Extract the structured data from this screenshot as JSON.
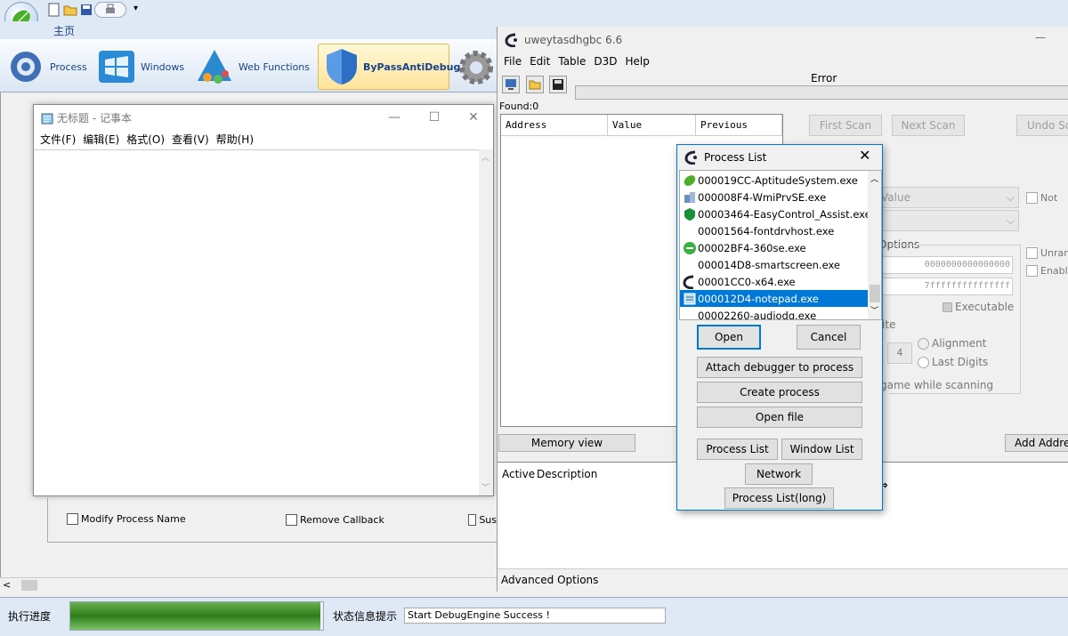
{
  "outer": {
    "home_tab": "主页",
    "ribbon": [
      {
        "label": "Process",
        "icon": "process-icon"
      },
      {
        "label": "Windows",
        "icon": "windows-icon"
      },
      {
        "label": "Web Functions",
        "icon": "web-icon"
      },
      {
        "label": "ByPassAntiDebug",
        "icon": "shield-icon",
        "selected": true
      }
    ],
    "checkboxes": [
      "Modify Process Name",
      "Remove Callback",
      "Sus"
    ],
    "hscroll_left": "<",
    "progress_label": "执行进度",
    "progress_value": 0.99,
    "status_label": "状态信息提示",
    "status_text": "Start DebugEngine Success !"
  },
  "notepad": {
    "title": "无标题 - 记事本",
    "menu": [
      "文件(F)",
      "编辑(E)",
      "格式(O)",
      "查看(V)",
      "帮助(H)"
    ],
    "minimize": "—",
    "maximize": "☐",
    "close": "✕"
  },
  "ce": {
    "title": "uweytasdhgbc 6.6",
    "minimize": "—",
    "menu": [
      "File",
      "Edit",
      "Table",
      "D3D",
      "Help"
    ],
    "error_label": "Error",
    "found_label": "Found:0",
    "columns": [
      "Address",
      "Value",
      "Previous"
    ],
    "first_scan": "First Scan",
    "next_scan": "Next Scan",
    "undo_scan": "Undo Sc",
    "value_type": "Value",
    "not_label": "Not",
    "options_label": "Options",
    "start_addr": "0000000000000000",
    "stop_addr": "7fffffffffffffff",
    "executable": "Executable",
    "writable_suffix": "ite",
    "align_value": "4",
    "alignment": "Alignment",
    "last_digits": "Last Digits",
    "pause_text": "game while scanning",
    "unrandomizer": "Unran",
    "enable_speed": "Enabl",
    "memory_view": "Memory view",
    "add_address": "Add Addre",
    "active_col": "Active",
    "description_col": "Description",
    "advanced_options": "Advanced Options"
  },
  "process_list": {
    "title": "Process List",
    "close": "✕",
    "items": [
      {
        "text": "000019CC-AptitudeSystem.exe",
        "icon": "leaf-icon"
      },
      {
        "text": "000008F4-WmiPrvSE.exe",
        "icon": "wmi-icon"
      },
      {
        "text": "00003464-EasyControl_Assist.exe",
        "icon": "shield-icon"
      },
      {
        "text": "00001564-fontdrvhost.exe",
        "icon": ""
      },
      {
        "text": "00002BF4-360se.exe",
        "icon": "browser-icon"
      },
      {
        "text": "000014D8-smartscreen.exe",
        "icon": ""
      },
      {
        "text": "00001CC0-x64.exe",
        "icon": "cheatengine-icon"
      },
      {
        "text": "000012D4-notepad.exe",
        "icon": "notepad-icon",
        "selected": true
      },
      {
        "text": "00002260-audiodg.exe",
        "icon": ""
      }
    ],
    "open": "Open",
    "cancel": "Cancel",
    "attach": "Attach debugger to process",
    "create": "Create process",
    "open_file": "Open file",
    "process_list_btn": "Process List",
    "window_list_btn": "Window List",
    "network": "Network",
    "process_list_long": "Process List(long)"
  },
  "colors": {
    "accent": "#0078d7",
    "ribbon": "#dfe9f5",
    "progress": "#2e7d1a"
  }
}
